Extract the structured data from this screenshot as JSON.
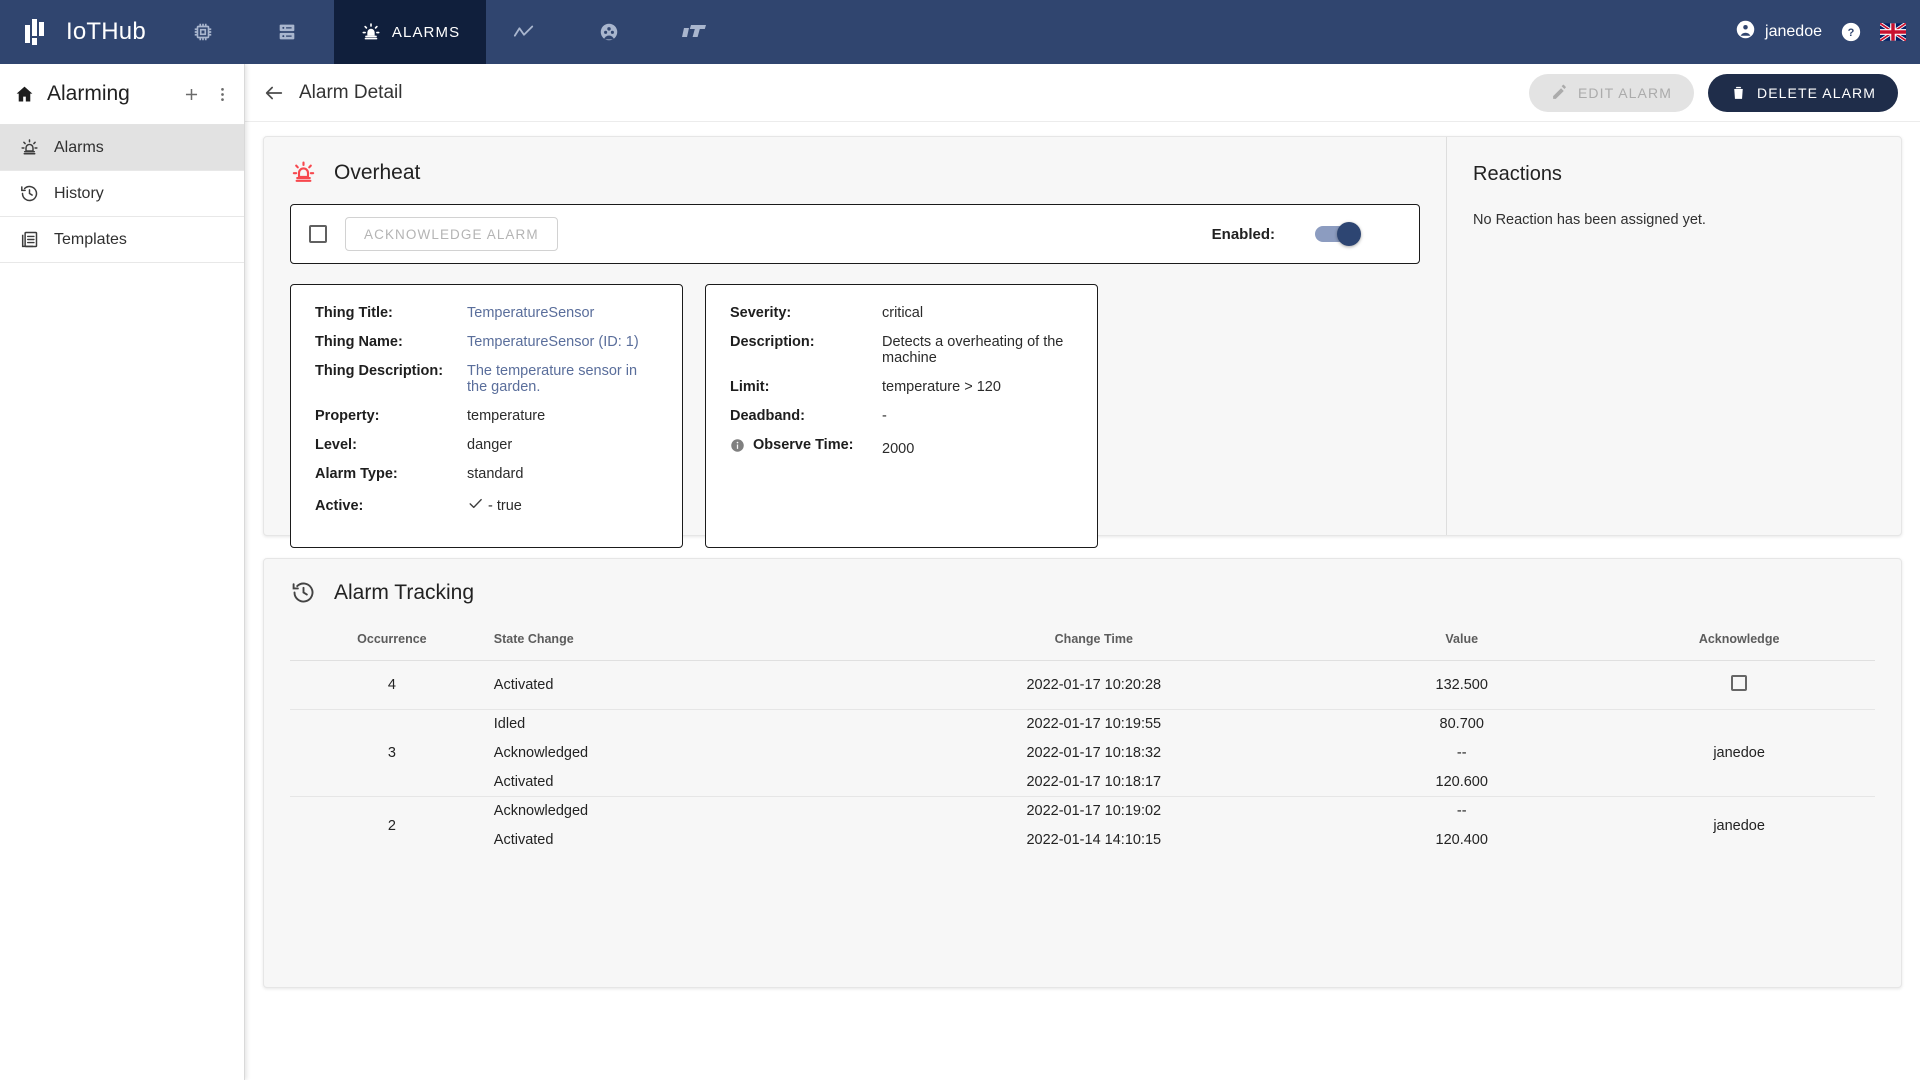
{
  "topbar": {
    "brand": "IoTHub",
    "brand_logo_icon": "iothub-logo-icon",
    "nav": [
      {
        "label": "",
        "icon": "microchip-icon",
        "active": false
      },
      {
        "label": "",
        "icon": "server-storage-icon",
        "active": false
      },
      {
        "label": "ALARMS",
        "icon": "alarm-siren-icon",
        "active": true
      },
      {
        "label": "",
        "icon": "trend-line-icon",
        "active": false
      },
      {
        "label": "",
        "icon": "group-people-icon",
        "active": false
      },
      {
        "label": "",
        "icon": "lt-logo-icon",
        "active": false
      }
    ],
    "user": "janedoe",
    "user_icon": "account-circle-icon",
    "help_icon": "help-circle-icon",
    "language_flag": "uk-flag-icon",
    "bg_color": "#30456f",
    "active_bg_color": "#101f3c"
  },
  "sidebar": {
    "title": "Alarming",
    "home_icon": "home-icon",
    "add_icon": "plus-icon",
    "more_icon": "more-vertical-icon",
    "items": [
      {
        "label": "Alarms",
        "icon": "alarm-siren-icon",
        "active": true
      },
      {
        "label": "History",
        "icon": "history-clock-icon",
        "active": false
      },
      {
        "label": "Templates",
        "icon": "templates-icon",
        "active": false
      }
    ]
  },
  "toolbar": {
    "back_icon": "arrow-left-icon",
    "title": "Alarm Detail",
    "edit_label": "EDIT ALARM",
    "edit_icon": "pencil-icon",
    "edit_disabled": true,
    "delete_label": "DELETE ALARM",
    "delete_icon": "trash-icon"
  },
  "alarm": {
    "icon": "alarm-siren-icon",
    "icon_color": "#f7484e",
    "title": "Overheat",
    "acknowledge_label": "ACKNOWLEDGE ALARM",
    "acknowledge_disabled": true,
    "enabled_label": "Enabled:",
    "enabled_value": true,
    "left_details": [
      {
        "key": "Thing Title:",
        "value": "TemperatureSensor",
        "link": true
      },
      {
        "key": "Thing Name:",
        "value": "TemperatureSensor (ID: 1)",
        "link": true
      },
      {
        "key": "Thing Description:",
        "value": "The temperature sensor in the garden.",
        "link": true
      },
      {
        "key": "Property:",
        "value": "temperature",
        "link": false
      },
      {
        "key": "Level:",
        "value": "danger",
        "link": false
      },
      {
        "key": "Alarm Type:",
        "value": "standard",
        "link": false
      },
      {
        "key": "Active:",
        "value": "- true",
        "link": false,
        "icon": "check-icon"
      }
    ],
    "right_details": [
      {
        "key": "Severity:",
        "value": "critical"
      },
      {
        "key": "Description:",
        "value": "Detects a overheating of the machine"
      },
      {
        "key": "Limit:",
        "value": "temperature > 120"
      },
      {
        "key": "Deadband:",
        "value": "-"
      },
      {
        "key": "Observe Time:",
        "value": "2000",
        "icon": "info-icon"
      }
    ]
  },
  "reactions": {
    "title": "Reactions",
    "empty_text": "No Reaction has been assigned yet."
  },
  "tracking": {
    "icon": "history-clock-icon",
    "title": "Alarm Tracking",
    "columns": [
      "Occurrence",
      "State Change",
      "Change Time",
      "Value",
      "Acknowledge"
    ],
    "groups": [
      {
        "occurrence": "4",
        "acknowledge": "",
        "acknowledge_checkbox": true,
        "rows": [
          {
            "state": "Activated",
            "time": "2022-01-17 10:20:28",
            "value": "132.500"
          }
        ]
      },
      {
        "occurrence": "3",
        "acknowledge": "janedoe",
        "acknowledge_checkbox": false,
        "rows": [
          {
            "state": "Idled",
            "time": "2022-01-17 10:19:55",
            "value": "80.700"
          },
          {
            "state": "Acknowledged",
            "time": "2022-01-17 10:18:32",
            "value": "--"
          },
          {
            "state": "Activated",
            "time": "2022-01-17 10:18:17",
            "value": "120.600"
          }
        ]
      },
      {
        "occurrence": "2",
        "acknowledge": "janedoe",
        "acknowledge_checkbox": false,
        "rows": [
          {
            "state": "Acknowledged",
            "time": "2022-01-17 10:19:02",
            "value": "--"
          },
          {
            "state": "Activated",
            "time": "2022-01-14 14:10:15",
            "value": "120.400"
          }
        ]
      }
    ]
  }
}
